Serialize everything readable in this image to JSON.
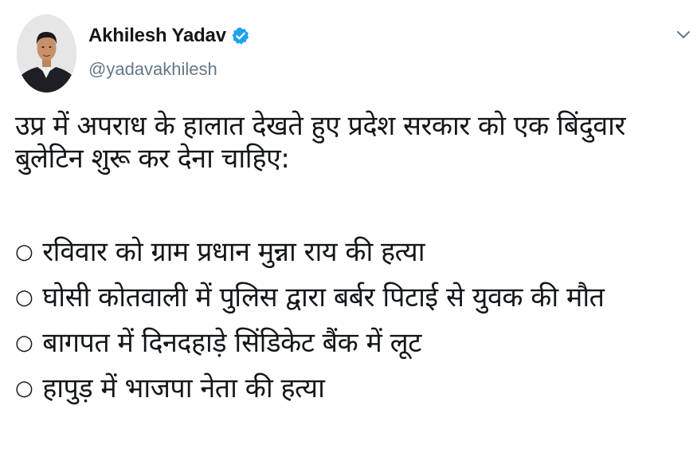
{
  "author": {
    "display_name": "Akhilesh Yadav",
    "handle": "@yadavakhilesh",
    "verified": true,
    "verified_icon": "verified-badge-icon",
    "avatar_icon": "profile-avatar"
  },
  "menu": {
    "caret_icon": "chevron-down-icon"
  },
  "tweet": {
    "lines": [
      "उप्र में अपराध के हालात देखते हुए प्रदेश सरकार को एक बिंदुवार",
      "बुलेटिन शुरू कर देना चाहिए:"
    ],
    "bullet_mark": "○",
    "bullets": [
      "रविवार को ग्राम प्रधान मुन्ना राय की हत्या",
      "घोसी कोतवाली में पुलिस द्वारा बर्बर पिटाई से युवक की मौत",
      "बागपत में दिनदहाड़े सिंडिकेट बैंक में लूट",
      "हापुड़ में भाजपा नेता की हत्या"
    ]
  },
  "colors": {
    "text": "#14171a",
    "secondary": "#657786",
    "verified_blue": "#1da1f2"
  }
}
